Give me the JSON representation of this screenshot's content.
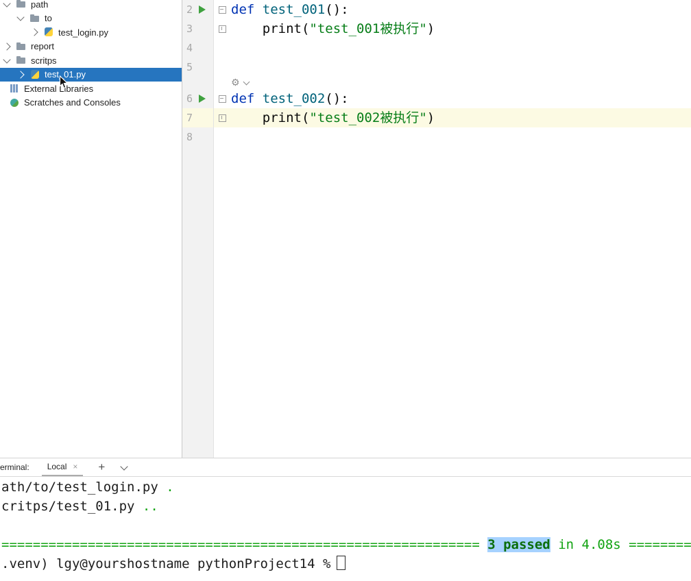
{
  "colors": {
    "selection": "#2675BF",
    "run_green": "#3FA13F",
    "string_green": "#067D17",
    "keyword_blue": "#0033B3",
    "func_teal": "#00627A",
    "pass_green": "#12A312",
    "selection_highlight": "#A6D2FF",
    "current_line": "#FCFAE3",
    "gutter_bg": "#F2F2F2"
  },
  "project_tree": {
    "items": [
      {
        "label": "path",
        "icon": "folder",
        "chevron": "down",
        "indent": 0,
        "selected": false
      },
      {
        "label": "to",
        "icon": "folder",
        "chevron": "down",
        "indent": 1,
        "selected": false
      },
      {
        "label": "test_login.py",
        "icon": "python-file",
        "chevron": "right",
        "indent": 2,
        "selected": false
      },
      {
        "label": "report",
        "icon": "folder",
        "chevron": "right",
        "indent": 0,
        "selected": false
      },
      {
        "label": "scritps",
        "icon": "folder",
        "chevron": "down",
        "indent": 0,
        "selected": false
      },
      {
        "label": "test_01.py",
        "icon": "python-file",
        "chevron": "right",
        "indent": 1,
        "selected": true
      },
      {
        "label": "External Libraries",
        "icon": "libraries",
        "chevron": "none",
        "indent": 0,
        "selected": false
      },
      {
        "label": "Scratches and Consoles",
        "icon": "scratches",
        "chevron": "none",
        "indent": 0,
        "selected": false
      }
    ]
  },
  "editor": {
    "rows": [
      {
        "kind": "code",
        "number": "2",
        "run": true,
        "fold": "start",
        "current": false,
        "segments": [
          {
            "text": "def",
            "type": "kw"
          },
          {
            "text": " ",
            "type": ""
          },
          {
            "text": "test_001",
            "type": "fn"
          },
          {
            "text": "():",
            "type": ""
          }
        ]
      },
      {
        "kind": "code",
        "number": "3",
        "fold": "end",
        "current": false,
        "segments": [
          {
            "text": "    print(",
            "type": ""
          },
          {
            "text": "\"test_001被执行\"",
            "type": "str"
          },
          {
            "text": ")",
            "type": ""
          }
        ]
      },
      {
        "kind": "code",
        "number": "4",
        "current": false,
        "segments": []
      },
      {
        "kind": "code",
        "number": "5",
        "current": false,
        "segments": []
      },
      {
        "kind": "inlay"
      },
      {
        "kind": "code",
        "number": "6",
        "run": true,
        "fold": "start",
        "current": false,
        "segments": [
          {
            "text": "def",
            "type": "kw"
          },
          {
            "text": " ",
            "type": ""
          },
          {
            "text": "test_002",
            "type": "fn"
          },
          {
            "text": "():",
            "type": ""
          }
        ]
      },
      {
        "kind": "code",
        "number": "7",
        "fold": "end",
        "current": true,
        "segments": [
          {
            "text": "    print(",
            "type": ""
          },
          {
            "text": "\"test_002被执行\"",
            "type": "str"
          },
          {
            "text": ")",
            "type": ""
          }
        ]
      },
      {
        "kind": "code",
        "number": "8",
        "current": false,
        "segments": []
      }
    ],
    "inlay_gear": "⚙"
  },
  "terminal": {
    "label": "erminal:",
    "tab_label": "Local",
    "close_label": "×",
    "new_tab_label": "+",
    "lines": [
      {
        "segments": [
          {
            "text": "ath/to/test_login.py",
            "type": "plain"
          },
          {
            "text": " .",
            "type": "pass"
          }
        ]
      },
      {
        "segments": [
          {
            "text": "critps/test_01.py",
            "type": "plain"
          },
          {
            "text": " ..",
            "type": "pass"
          }
        ]
      },
      {
        "segments": []
      },
      {
        "segments": [
          {
            "text": "=============================================================",
            "type": "green"
          },
          {
            "text": " ",
            "type": "green"
          },
          {
            "text": "3 passed",
            "type": "passed"
          },
          {
            "text": " ",
            "type": "plain"
          },
          {
            "text": "in 4.08s",
            "type": "green"
          },
          {
            "text": " ",
            "type": "green"
          },
          {
            "text": "================",
            "type": "green"
          }
        ]
      },
      {
        "segments": [
          {
            "text": ".venv) lgy@yourshostname pythonProject14 %",
            "type": "plain"
          },
          {
            "type": "cursor"
          }
        ]
      }
    ]
  }
}
